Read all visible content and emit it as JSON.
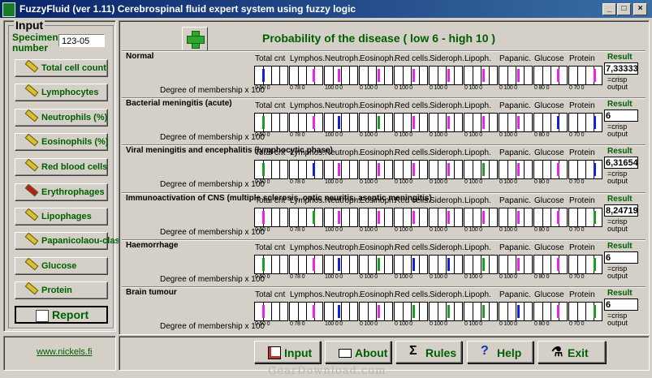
{
  "window": {
    "title": "FuzzyFluid  (ver 1.11) Cerebrospinal fluid expert system using fuzzy logic",
    "minimize": "_",
    "maximize": "□",
    "close": "×"
  },
  "input_panel": {
    "title": "Input",
    "specimen_label_1": "Specimen",
    "specimen_label_2": "number",
    "specimen_value": "123-05",
    "buttons": [
      "Total cell count",
      "Lymphocytes",
      "Neutrophils (%)",
      "Eosinophils (%)",
      "Red blood cells",
      "Erythrophages",
      "Lipophages",
      "Papanicolaou-class",
      "Glucose",
      "Protein"
    ],
    "report": "Report",
    "link": "www.nickels.fi"
  },
  "header": "Probability of the disease ( low 6 - high 10 )",
  "columns": [
    "Total cnt",
    "Lymphos.",
    "Neutroph.",
    "Eosinoph.",
    "Red cells.",
    "Sideroph.",
    "Lipoph.",
    "Papanic.",
    "Glucose",
    "Protein"
  ],
  "degree_label": "Degree of membership x 100",
  "result_label": "Result",
  "crisp_label": "=crisp output",
  "colors": {
    "blue": "#1020e0",
    "magenta": "#f020f0",
    "green": "#18a020",
    "accent_green": "#006000"
  },
  "diseases": [
    {
      "name": "Normal",
      "result": "7,33333",
      "cells": [
        {
          "c": "blue",
          "v": "50"
        },
        {
          "c": "magenta",
          "v": "78"
        },
        {
          "c": "magenta",
          "v": "100"
        },
        {
          "c": "magenta",
          "v": "100"
        },
        {
          "c": "magenta",
          "v": "100"
        },
        {
          "c": "magenta",
          "v": "100"
        },
        {
          "c": "magenta",
          "v": "100"
        },
        {
          "c": "magenta",
          "v": "100"
        },
        {
          "c": "magenta",
          "v": "80"
        },
        {
          "c": "magenta",
          "v": "70"
        }
      ]
    },
    {
      "name": "Bacterial meningitis (acute)",
      "result": "6",
      "cells": [
        {
          "c": "green",
          "v": "50"
        },
        {
          "c": "magenta",
          "v": "78"
        },
        {
          "c": "blue",
          "v": "100"
        },
        {
          "c": "green",
          "v": "100"
        },
        {
          "c": "magenta",
          "v": "100"
        },
        {
          "c": "magenta",
          "v": "100"
        },
        {
          "c": "magenta",
          "v": "100"
        },
        {
          "c": "magenta",
          "v": "100"
        },
        {
          "c": "blue",
          "v": "80"
        },
        {
          "c": "blue",
          "v": "70"
        }
      ]
    },
    {
      "name": "Viral meningitis and encephalitis (lymphocytic phase)",
      "result": "6,31654",
      "cells": [
        {
          "c": "green",
          "v": "50"
        },
        {
          "c": "blue",
          "v": "78"
        },
        {
          "c": "magenta",
          "v": "100"
        },
        {
          "c": "magenta",
          "v": "100"
        },
        {
          "c": "magenta",
          "v": "100"
        },
        {
          "c": "magenta",
          "v": "100"
        },
        {
          "c": "green",
          "v": "100"
        },
        {
          "c": "magenta",
          "v": "100"
        },
        {
          "c": "magenta",
          "v": "80"
        },
        {
          "c": "blue",
          "v": "70"
        }
      ]
    },
    {
      "name": "Immunoactivation of CNS (multiple sclerosis, optic neuritis, aseptic meningitis)",
      "result": "8,24719",
      "cells": [
        {
          "c": "magenta",
          "v": "50"
        },
        {
          "c": "green",
          "v": "78"
        },
        {
          "c": "magenta",
          "v": "100"
        },
        {
          "c": "magenta",
          "v": "100"
        },
        {
          "c": "magenta",
          "v": "100"
        },
        {
          "c": "magenta",
          "v": "100"
        },
        {
          "c": "magenta",
          "v": "100"
        },
        {
          "c": "magenta",
          "v": "100"
        },
        {
          "c": "magenta",
          "v": "80"
        },
        {
          "c": "green",
          "v": "70"
        }
      ]
    },
    {
      "name": "Haemorrhage",
      "result": "6",
      "cells": [
        {
          "c": "green",
          "v": "50"
        },
        {
          "c": "magenta",
          "v": "78"
        },
        {
          "c": "blue",
          "v": "100"
        },
        {
          "c": "green",
          "v": "100"
        },
        {
          "c": "blue",
          "v": "100"
        },
        {
          "c": "blue",
          "v": "100"
        },
        {
          "c": "green",
          "v": "100"
        },
        {
          "c": "magenta",
          "v": "100"
        },
        {
          "c": "magenta",
          "v": "80"
        },
        {
          "c": "green",
          "v": "70"
        }
      ]
    },
    {
      "name": "Brain tumour",
      "result": "6",
      "cells": [
        {
          "c": "magenta",
          "v": "50"
        },
        {
          "c": "magenta",
          "v": "78"
        },
        {
          "c": "blue",
          "v": "100"
        },
        {
          "c": "magenta",
          "v": "100"
        },
        {
          "c": "green",
          "v": "100"
        },
        {
          "c": "green",
          "v": "100"
        },
        {
          "c": "green",
          "v": "100"
        },
        {
          "c": "blue",
          "v": "100"
        },
        {
          "c": "magenta",
          "v": "80"
        },
        {
          "c": "green",
          "v": "70"
        }
      ]
    }
  ],
  "bottom_buttons": [
    {
      "label": "Input",
      "icon": "chart-icon"
    },
    {
      "label": "About",
      "icon": "about-icon"
    },
    {
      "label": "Rules",
      "icon": "sigma-icon"
    },
    {
      "label": "Help",
      "icon": "help-icon"
    },
    {
      "label": "Exit",
      "icon": "exit-icon"
    }
  ],
  "watermark": "GearDownload.com"
}
